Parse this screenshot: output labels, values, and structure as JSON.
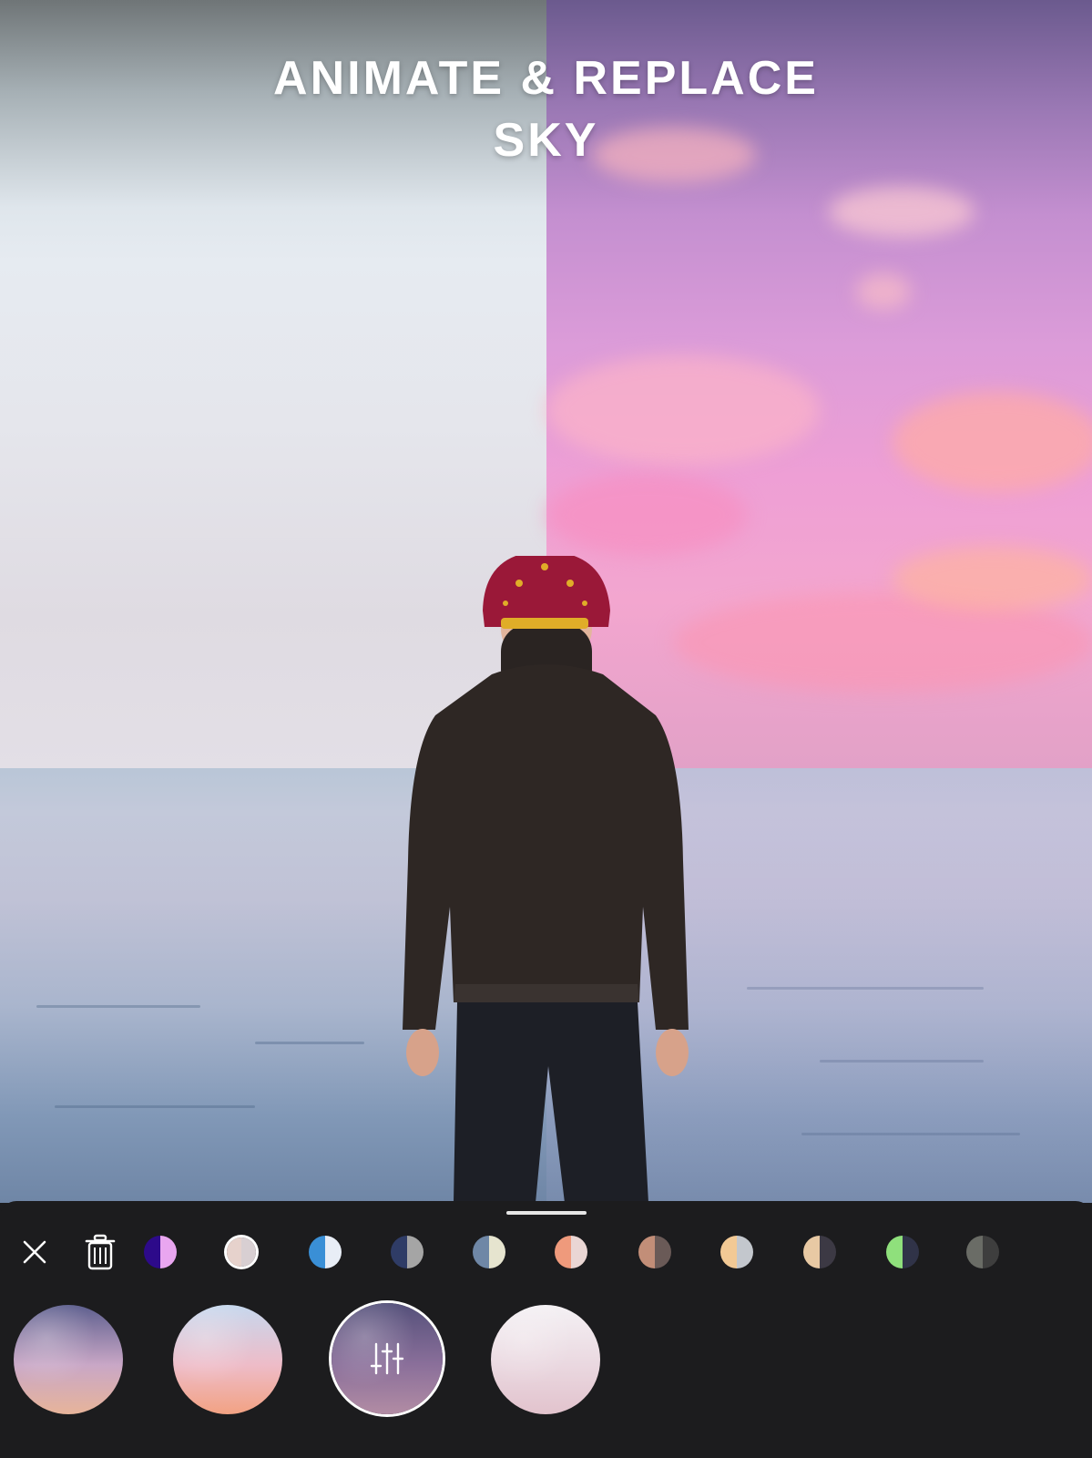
{
  "title": {
    "line1": "ANIMATE & REPLACE",
    "line2": "SKY"
  },
  "toolbar": {
    "close_icon": "close-icon",
    "delete_icon": "trash-icon",
    "swatches": [
      {
        "left": "#2d0a8a",
        "right": "#e9a6f0"
      },
      {
        "left": "#e6d2cc",
        "right": "#d8cfd2"
      },
      {
        "left": "#3a8fd6",
        "right": "#e8edf6"
      },
      {
        "left": "#2f3c66",
        "right": "#a5a5a5"
      },
      {
        "left": "#6f87a6",
        "right": "#e6e4cf"
      },
      {
        "left": "#ef9a7c",
        "right": "#ead6d4"
      },
      {
        "left": "#c28e78",
        "right": "#6a5a57"
      },
      {
        "left": "#f2c995",
        "right": "#c3c7cd"
      },
      {
        "left": "#e8c9a4",
        "right": "#3c3944"
      },
      {
        "left": "#8fe07c",
        "right": "#303348"
      },
      {
        "left": "#6a6c66",
        "right": "#3e3e3e"
      }
    ]
  },
  "skies": [
    {
      "name": "cloudy-dusk",
      "colors": [
        "#5d5f8e",
        "#c9a7c6",
        "#e7b49a"
      ]
    },
    {
      "name": "pastel-sunset",
      "colors": [
        "#c6d8ee",
        "#eebcc8",
        "#f2a283"
      ]
    },
    {
      "name": "purple-evening",
      "colors": [
        "#54507a",
        "#8a6f9a",
        "#b28ca4"
      ],
      "active": true,
      "icon": "sliders-icon"
    },
    {
      "name": "soft-pink",
      "colors": [
        "#f4f1f4",
        "#ead8e0",
        "#e2c3cd"
      ]
    }
  ],
  "colors": {
    "panel": "#1c1c1e",
    "accent": "#ffffff"
  }
}
